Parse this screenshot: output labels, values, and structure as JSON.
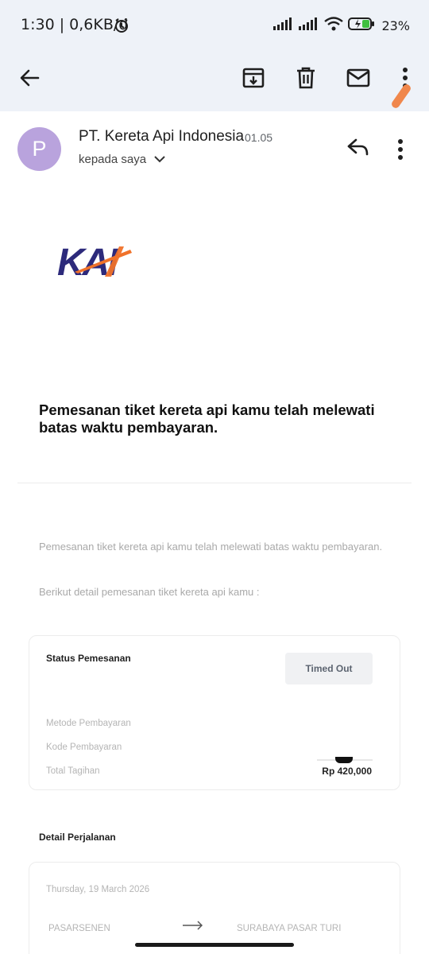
{
  "status_bar": {
    "time": "1:30",
    "speed": "0,6KB/d",
    "battery": "23%",
    "icons": [
      "alarm-icon",
      "signal-icon",
      "signal-icon",
      "wifi-icon",
      "battery-icon"
    ]
  },
  "app_bar": {
    "icons": [
      "back-arrow-icon",
      "archive-icon",
      "delete-icon",
      "mark-unread-icon",
      "more-vert-icon"
    ],
    "accent": "#f0874c"
  },
  "email": {
    "avatar_letter": "P",
    "avatar_color": "#b9a3dd",
    "sender": "PT. Kereta Api Indonesia",
    "time": "01.05",
    "to": "kepada saya",
    "logo_text": "KAI",
    "logo_colors": {
      "primary": "#2d2a7b",
      "accent": "#f0722a"
    },
    "headline": "Pemesanan tiket kereta api kamu telah melewati batas waktu pembayaran.",
    "paragraph1": "Pemesanan tiket kereta api kamu telah melewati batas waktu pembayaran.",
    "paragraph2": "Berikut detail pemesanan tiket kereta api kamu :"
  },
  "order_card": {
    "title": "Status Pemesanan",
    "status": "Timed Out",
    "rows": [
      {
        "label": "Metode Pembayaran",
        "value": ""
      },
      {
        "label": "Kode Pembayaran",
        "value": ""
      },
      {
        "label": "Total Tagihan",
        "value": "Rp 420,000"
      }
    ]
  },
  "trip": {
    "section_title": "Detail Perjalanan",
    "date": "Thursday, 19 March 2026",
    "from": "PASARSENEN",
    "to": "SURABAYA PASAR TURI"
  }
}
